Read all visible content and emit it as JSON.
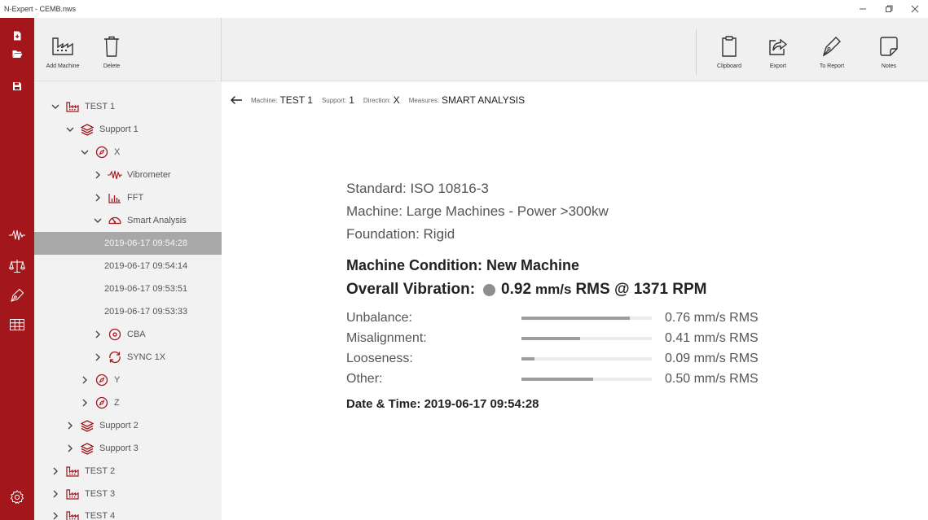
{
  "window": {
    "title": "N-Expert - CEMB.nws",
    "controls": [
      "minimize",
      "restore",
      "close"
    ]
  },
  "rail": {
    "top_items": [
      {
        "icon": "new-file-icon"
      },
      {
        "icon": "open-folder-icon"
      },
      {
        "icon": "save-icon"
      }
    ],
    "mid_items": [
      {
        "icon": "vibrometer-icon",
        "active": true
      },
      {
        "icon": "balance-icon"
      },
      {
        "icon": "pen-icon"
      },
      {
        "icon": "grid-icon"
      }
    ],
    "bottom_item": {
      "icon": "settings-icon"
    },
    "color": "#a3161c"
  },
  "toolbar": {
    "add_machine": "Add Machine",
    "delete": "Delete",
    "clipboard": "Clipboard",
    "export": "Export",
    "to_report": "To Report",
    "notes": "Notes"
  },
  "tree": {
    "rows": [
      {
        "label": "TEST 1",
        "icon": "machine-icon",
        "level": 0,
        "expanded": true
      },
      {
        "label": "Support 1",
        "icon": "support-icon",
        "level": 1,
        "expanded": true
      },
      {
        "label": "X",
        "icon": "direction-icon",
        "level": 2,
        "expanded": true
      },
      {
        "label": "Vibrometer",
        "icon": "vibrometer-icon",
        "level": 3,
        "expanded": false
      },
      {
        "label": "FFT",
        "icon": "fft-icon",
        "level": 3,
        "expanded": false
      },
      {
        "label": "Smart Analysis",
        "icon": "smart-analysis-icon",
        "level": 3,
        "expanded": true
      },
      {
        "label": "2019-06-17 09:54:28",
        "icon": "",
        "level": 4,
        "selected": true
      },
      {
        "label": "2019-06-17 09:54:14",
        "icon": "",
        "level": 4
      },
      {
        "label": "2019-06-17 09:53:51",
        "icon": "",
        "level": 4
      },
      {
        "label": "2019-06-17 09:53:33",
        "icon": "",
        "level": 4
      },
      {
        "label": "CBA",
        "icon": "cba-icon",
        "level": 3,
        "expanded": false
      },
      {
        "label": "SYNC 1X",
        "icon": "sync-icon",
        "level": 3,
        "expanded": false
      },
      {
        "label": "Y",
        "icon": "direction-icon",
        "level": 2,
        "expanded": false
      },
      {
        "label": "Z",
        "icon": "direction-icon",
        "level": 2,
        "expanded": false
      },
      {
        "label": "Support 2",
        "icon": "support-icon",
        "level": 1,
        "expanded": false
      },
      {
        "label": "Support 3",
        "icon": "support-icon",
        "level": 1,
        "expanded": false
      },
      {
        "label": "TEST 2",
        "icon": "machine-icon",
        "level": 0,
        "expanded": false
      },
      {
        "label": "TEST 3",
        "icon": "machine-icon",
        "level": 0,
        "expanded": false
      },
      {
        "label": "TEST 4",
        "icon": "machine-icon",
        "level": 0,
        "expanded": false
      }
    ]
  },
  "breadcrumb": {
    "machine_key": "Machine:",
    "machine": "TEST 1",
    "support_key": "Support:",
    "support": "1",
    "direction_key": "Direction:",
    "direction": "X",
    "measures_key": "Measures:",
    "measures": "SMART ANALYSIS"
  },
  "report": {
    "standard": "Standard: ISO 10816-3",
    "machine": "Machine: Large Machines - Power >300kw",
    "foundation": "Foundation: Rigid",
    "condition": "Machine Condition: New Machine",
    "overall_label": "Overall Vibration:",
    "overall_value": "0.92",
    "overall_unit": "mm/s",
    "overall_rpm": "RMS @ 1371 RPM",
    "status_color": "#8e8e8e",
    "components": [
      {
        "label": "Unbalance:",
        "value": "0.76 mm/s RMS",
        "level": 0.83
      },
      {
        "label": "Misalignment:",
        "value": "0.41 mm/s RMS",
        "level": 0.45
      },
      {
        "label": "Looseness:",
        "value": "0.09 mm/s RMS",
        "level": 0.1
      },
      {
        "label": "Other:",
        "value": "0.50 mm/s RMS",
        "level": 0.55
      }
    ],
    "datetime": "Date & Time: 2019-06-17 09:54:28"
  }
}
